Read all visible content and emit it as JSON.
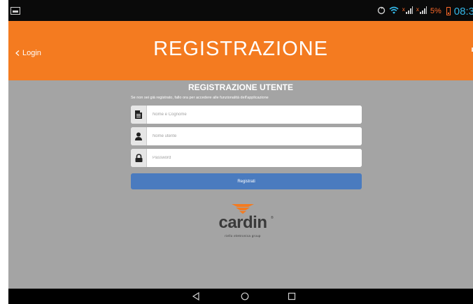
{
  "status_bar": {
    "battery_percent": "5%",
    "clock": "08:3",
    "icons": [
      "notification-icon",
      "sync-icon",
      "wifi-icon",
      "signal-icon",
      "signal-icon",
      "battery-icon"
    ]
  },
  "header": {
    "back_label": "Login",
    "title": "REGISTRAZIONE",
    "color": "#f47b20"
  },
  "form": {
    "heading": "REGISTRAZIONE UTENTE",
    "subtitle": "Se non sei già registrato, fallo ora per accedere alle funzionalità dell'applicazione",
    "fields": [
      {
        "icon": "document-icon",
        "placeholder": "Nome e Cognome",
        "value": ""
      },
      {
        "icon": "user-icon",
        "placeholder": "Nome utente",
        "value": ""
      },
      {
        "icon": "lock-icon",
        "placeholder": "Password",
        "value": ""
      }
    ],
    "submit_label": "Registrati",
    "submit_color": "#4a7bbf"
  },
  "logo": {
    "wordmark": "cardin",
    "tagline": "riello elettronica group",
    "registered": "®"
  },
  "nav_bar": {
    "buttons": [
      "back-icon",
      "home-icon",
      "recents-icon"
    ]
  }
}
